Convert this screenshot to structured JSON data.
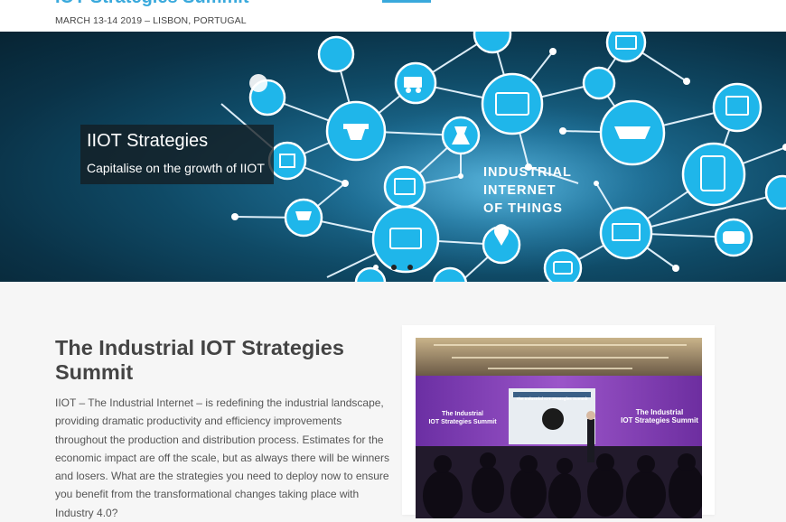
{
  "header": {
    "site_title": "IOT Strategies Summit",
    "event_info": "MARCH 13-14 2019 – LISBON, PORTUGAL"
  },
  "hero": {
    "slide_title": "IIOT Strategies",
    "slide_subtitle": "Capitalise on the growth of IIOT",
    "graphic_text": [
      "INDUSTRIAL",
      "INTERNET",
      "OF THINGS"
    ],
    "icons": [
      "wifi-icon",
      "truck-icon",
      "tablet-pen-icon",
      "network-icon",
      "envelope-icon",
      "globe-icon",
      "drone-icon",
      "oil-rig-icon",
      "flask-icon",
      "ship-icon",
      "chart-icon",
      "phone-app-icon",
      "image-icon",
      "cart-icon",
      "laptop-icon",
      "location-pin-icon",
      "binary-screen-icon",
      "chat-bubble-icon",
      "camera-icon",
      "tv-signal-icon"
    ],
    "slider_dots": 3,
    "colors": {
      "accent": "#39a9dc",
      "node": "#33c3f0"
    }
  },
  "main": {
    "title": "The Industrial IOT Strategies Summit",
    "intro": "IIOT – The Industrial Internet – is redefining the industrial landscape, providing dramatic productivity and efficiency improvements throughout the production and distribution process. Estimates for the economic impact are off the scale, but as always there will be winners and losers. What are the strategies you need to deploy now to ensure you benefit from the transformational changes taking place with Industry 4.0?"
  },
  "photo": {
    "screen_banner": "The Industrial IOT Strategies Summit",
    "left_banner": [
      "The Industrial",
      "IOT Strategies Summit"
    ],
    "right_banner": [
      "The Industrial",
      "IOT Strategies Summit"
    ]
  }
}
